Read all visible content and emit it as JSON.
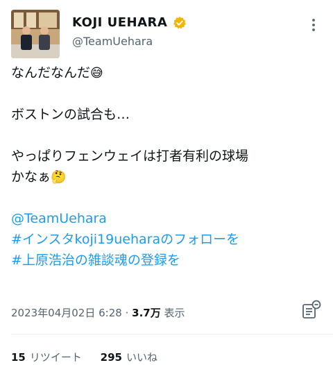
{
  "author": {
    "display_name": "KOJI UEHARA",
    "handle": "@TeamUehara",
    "verified_color": "#f4b400"
  },
  "tweet": {
    "line1": "なんだなんだ",
    "line1_emoji": "😅",
    "line2": "ボストンの試合も…",
    "line3": "やっぱりフェンウェイは打者有利の球場",
    "line4": "かなぁ",
    "line4_emoji": "🤔",
    "mention": "@TeamUehara",
    "hashtag1": "#インスタkoji19ueharaのフォローを",
    "hashtag2": "#上原浩治の雑談魂の登録を"
  },
  "meta": {
    "timestamp": "2023年04月02日 6:28",
    "separator": "·",
    "views_count": "3.7万",
    "views_label": "表示"
  },
  "stats": {
    "retweets_count": "15",
    "retweets_label": "リツイート",
    "likes_count": "295",
    "likes_label": "いいね"
  },
  "colors": {
    "link": "#1d9bf0",
    "secondary_text": "#536471"
  }
}
